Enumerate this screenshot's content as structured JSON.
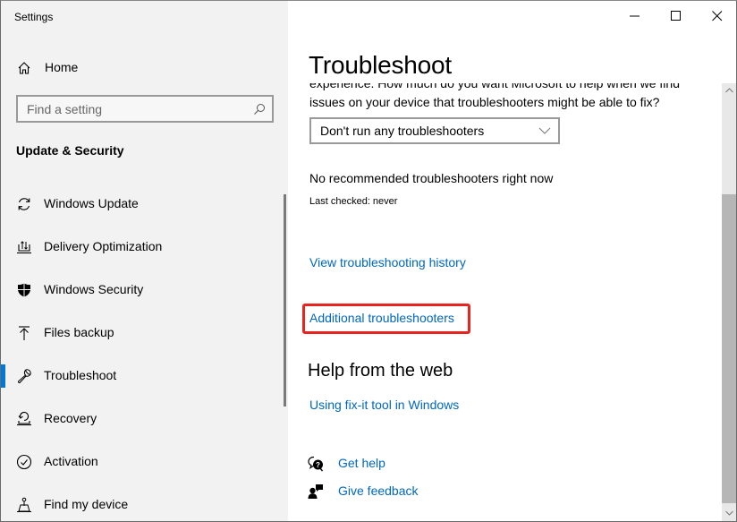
{
  "window": {
    "title": "Settings",
    "controls": [
      "minimize",
      "maximize",
      "close"
    ]
  },
  "sidebar": {
    "home_label": "Home",
    "search": {
      "placeholder": "Find a setting",
      "value": ""
    },
    "section_title": "Update & Security",
    "items": [
      {
        "label": "Windows Update",
        "icon": "refresh-icon",
        "active": false
      },
      {
        "label": "Delivery Optimization",
        "icon": "delivery-optimization-icon",
        "active": false
      },
      {
        "label": "Windows Security",
        "icon": "shield-icon",
        "active": false
      },
      {
        "label": "Files backup",
        "icon": "upload-arrow-icon",
        "active": false
      },
      {
        "label": "Troubleshoot",
        "icon": "wrench-icon",
        "active": true
      },
      {
        "label": "Recovery",
        "icon": "recovery-icon",
        "active": false
      },
      {
        "label": "Activation",
        "icon": "check-circle-icon",
        "active": false
      },
      {
        "label": "Find my device",
        "icon": "find-device-icon",
        "active": false
      }
    ],
    "accent_color": "#0078d7"
  },
  "main": {
    "title": "Troubleshoot",
    "partial_text": "experience. How much do you want Microsoft to help when we find",
    "question": "issues on your device that troubleshooters might be able to fix?",
    "dropdown": {
      "selected": "Don't run any troubleshooters"
    },
    "no_recommended": "No recommended troubleshooters right now",
    "last_checked": "Last checked: never",
    "links": {
      "history": "View troubleshooting history",
      "additional": "Additional troubleshooters"
    },
    "help_heading": "Help from the web",
    "help_links": {
      "fixit": "Using fix-it tool in Windows"
    },
    "footer": {
      "get_help": "Get help",
      "give_feedback": "Give feedback"
    },
    "link_color": "#0067c0",
    "highlight_color": "#e8241f"
  }
}
